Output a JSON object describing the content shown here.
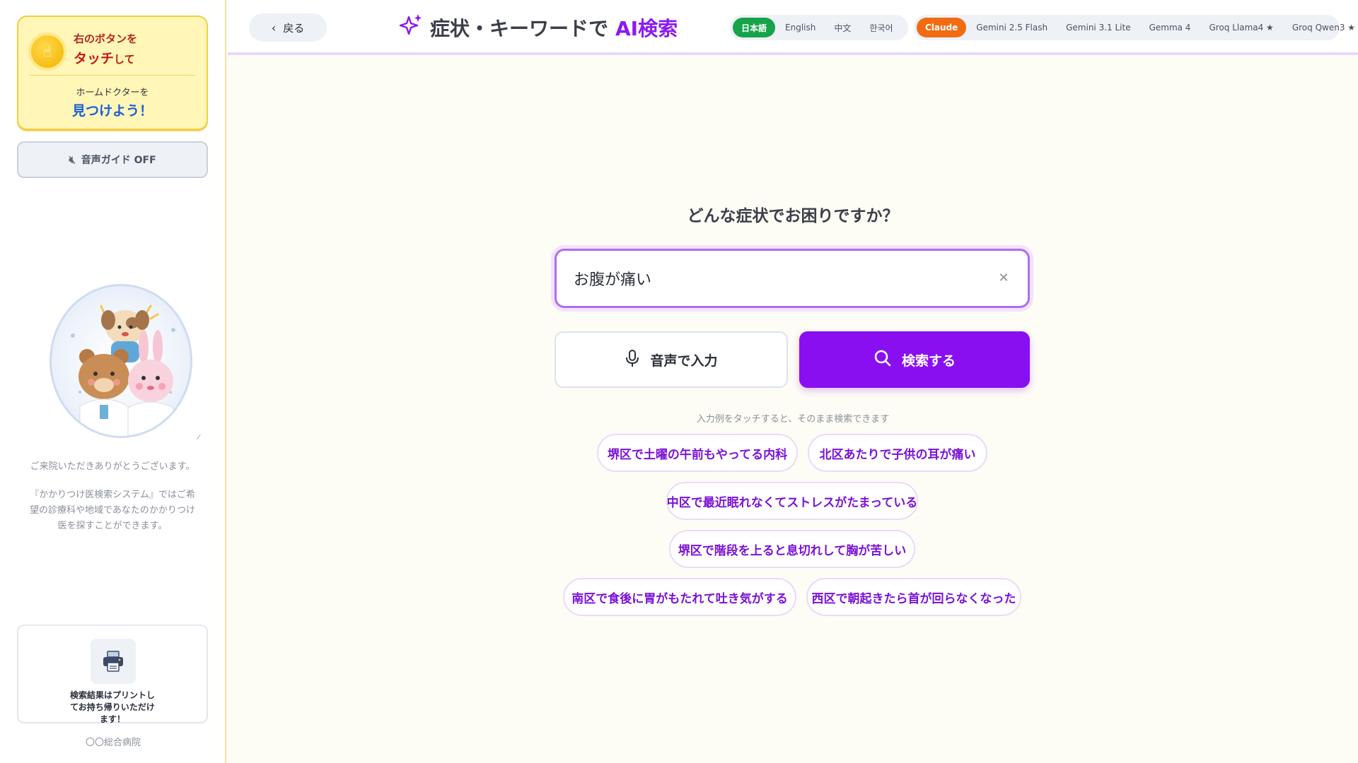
{
  "sidebar": {
    "touch_card": {
      "line1": "右のボタンを",
      "line2_main": "タッチ",
      "line2_suffix": "して",
      "line3": "ホームドクターを",
      "line4": "見つけよう！",
      "icon": "pointing-hand-icon"
    },
    "voice_guide": {
      "label": "音声ガイド OFF",
      "icon": "speaker-muted-icon"
    },
    "mascot_icon": "doctor-animals-illustration",
    "welcome": {
      "p1": "ご来院いただきありがとうございます。",
      "p2": "『かかりつけ医検索システム』ではご希望の診療科や地域であなたのかかりつけ医を探すことができます。"
    },
    "print_card": {
      "text": "検索結果はプリントしてお持ち帰りいただけます！",
      "icon": "printer-icon"
    },
    "hospital_name": "〇〇総合病院"
  },
  "header": {
    "back_label": "戻る",
    "title_main": "症状・キーワードで",
    "title_ai": "AI検索",
    "title_icon": "sparkle-icon",
    "languages": [
      {
        "label": "日本語",
        "active": true
      },
      {
        "label": "English",
        "active": false
      },
      {
        "label": "中文",
        "active": false
      },
      {
        "label": "한국어",
        "active": false
      }
    ],
    "models": [
      {
        "label": "Claude",
        "active": true
      },
      {
        "label": "Gemini 2.5 Flash",
        "active": false
      },
      {
        "label": "Gemini 3.1 Lite",
        "active": false
      },
      {
        "label": "Gemma 4",
        "active": false
      },
      {
        "label": "Groq Llama4 ★",
        "active": false
      },
      {
        "label": "Groq Qwen3 ★",
        "active": false
      }
    ]
  },
  "main": {
    "question": "どんな症状でお困りですか？",
    "search": {
      "value": "お腹が痛い",
      "clear_icon": "close-icon"
    },
    "voice_button": "音声で入力",
    "search_button": "検索する",
    "hint": "入力例をタッチすると、そのまま検索できます",
    "examples": [
      "堺区で土曜の午前もやってる内科",
      "北区あたりで子供の耳が痛い",
      "中区で最近眠れなくてストレスがたまっている",
      "堺区で階段を上ると息切れして胸が苦しい",
      "南区で食後に胃がもたれて吐き気がする",
      "西区で朝起きたら首が回らなくなった"
    ]
  },
  "colors": {
    "accent": "#8a0ff0",
    "lang_active": "#16a34a",
    "model_active": "#f26b12",
    "touch_card_bg": "#fff6b8"
  }
}
